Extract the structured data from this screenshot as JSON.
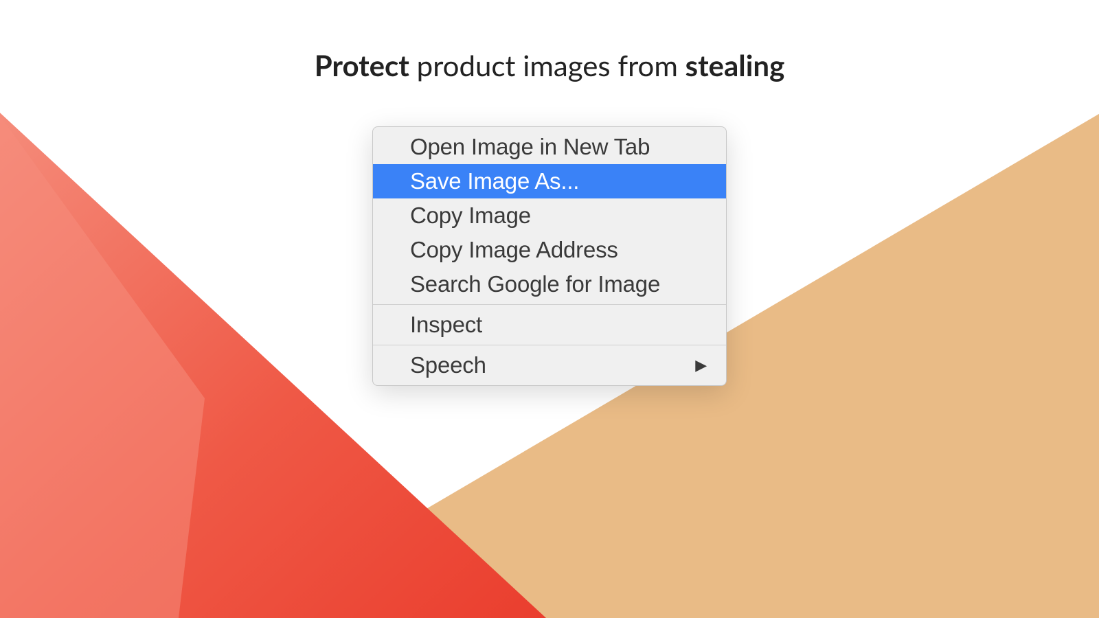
{
  "heading": {
    "part1_strong": "Protect",
    "part2": " product images from ",
    "part3_strong": "stealing"
  },
  "context_menu": {
    "groups": [
      {
        "items": [
          {
            "label": "Open Image in New Tab",
            "highlighted": false,
            "has_submenu": false
          },
          {
            "label": "Save Image As...",
            "highlighted": true,
            "has_submenu": false
          },
          {
            "label": "Copy Image",
            "highlighted": false,
            "has_submenu": false
          },
          {
            "label": "Copy Image Address",
            "highlighted": false,
            "has_submenu": false
          },
          {
            "label": "Search Google for Image",
            "highlighted": false,
            "has_submenu": false
          }
        ]
      },
      {
        "items": [
          {
            "label": "Inspect",
            "highlighted": false,
            "has_submenu": false
          }
        ]
      },
      {
        "items": [
          {
            "label": "Speech",
            "highlighted": false,
            "has_submenu": true
          }
        ]
      }
    ]
  },
  "submenu_glyph": "▶",
  "colors": {
    "triangle_left_top": "#f48070",
    "triangle_left_bottom": "#ee4a3a",
    "triangle_right": "#e9bb86",
    "highlight": "#3a82f7"
  }
}
